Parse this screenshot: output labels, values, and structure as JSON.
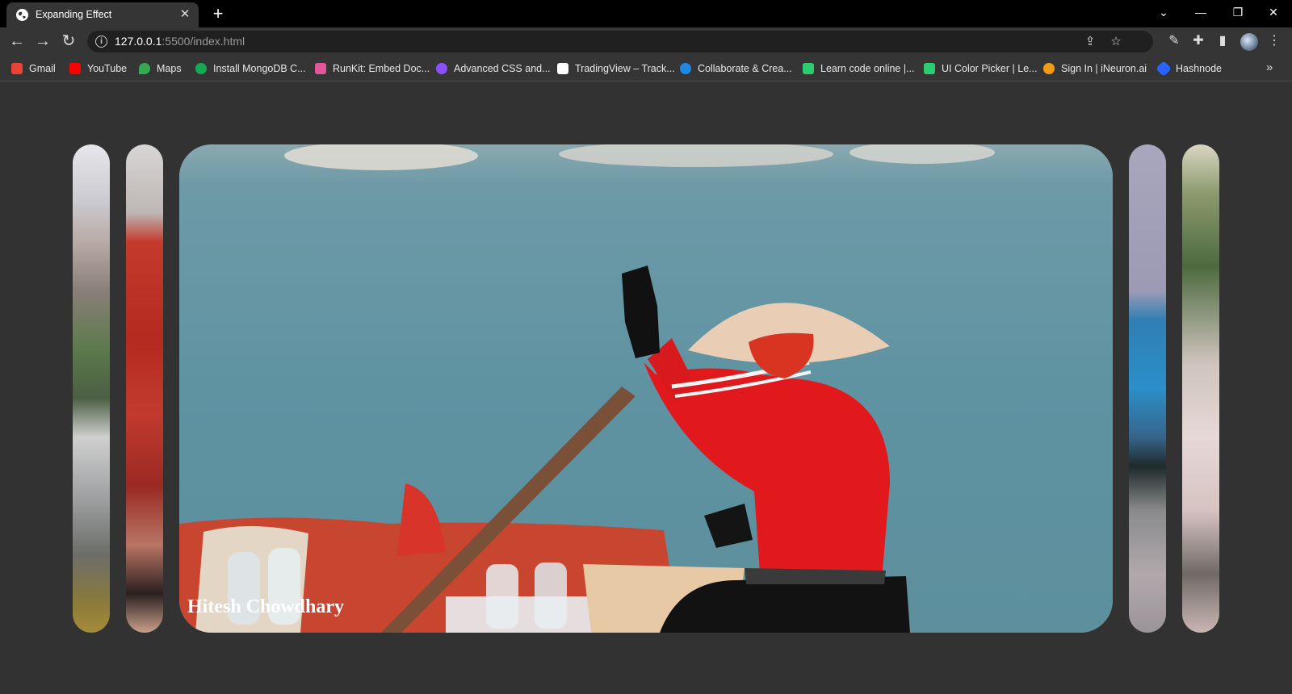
{
  "browser": {
    "tab": {
      "title": "Expanding Effect",
      "close": "✕"
    },
    "new_tab": "+",
    "window_controls": {
      "dropdown": "⌄",
      "minimize": "—",
      "restore": "❐",
      "close": "✕"
    },
    "nav": {
      "back": "←",
      "forward": "→",
      "reload": "↻"
    },
    "address": {
      "host": "127.0.0.1",
      "path": ":5500/index.html"
    },
    "bookmarks": [
      {
        "label": "Gmail",
        "icon": "gmail-icon",
        "color": "#ea4335"
      },
      {
        "label": "YouTube",
        "icon": "youtube-icon",
        "color": "#ff0000"
      },
      {
        "label": "Maps",
        "icon": "maps-icon",
        "color": "#34a853"
      },
      {
        "label": "Install MongoDB C...",
        "icon": "mongodb-icon",
        "color": "#13aa52"
      },
      {
        "label": "RunKit: Embed Doc...",
        "icon": "runkit-icon",
        "color": "#e2579a"
      },
      {
        "label": "Advanced CSS and...",
        "icon": "udemy-icon",
        "color": "#8a4fff"
      },
      {
        "label": "TradingView – Track...",
        "icon": "tradingview-icon",
        "color": "#ffffff"
      },
      {
        "label": "Collaborate & Crea...",
        "icon": "canva-icon",
        "color": "#1e88e5"
      },
      {
        "label": "Learn code online |...",
        "icon": "scrimba-icon",
        "color": "#2ecc71"
      },
      {
        "label": "UI Color Picker | Le...",
        "icon": "colorpicker-icon",
        "color": "#2ecc71"
      },
      {
        "label": "Sign In | iNeuron.ai",
        "icon": "ineuron-icon",
        "color": "#f39c12"
      },
      {
        "label": "Hashnode",
        "icon": "hashnode-icon",
        "color": "#2962ff"
      }
    ],
    "bookmarks_more": "»"
  },
  "gallery": {
    "caption": "Hitesh Chowdhary"
  }
}
